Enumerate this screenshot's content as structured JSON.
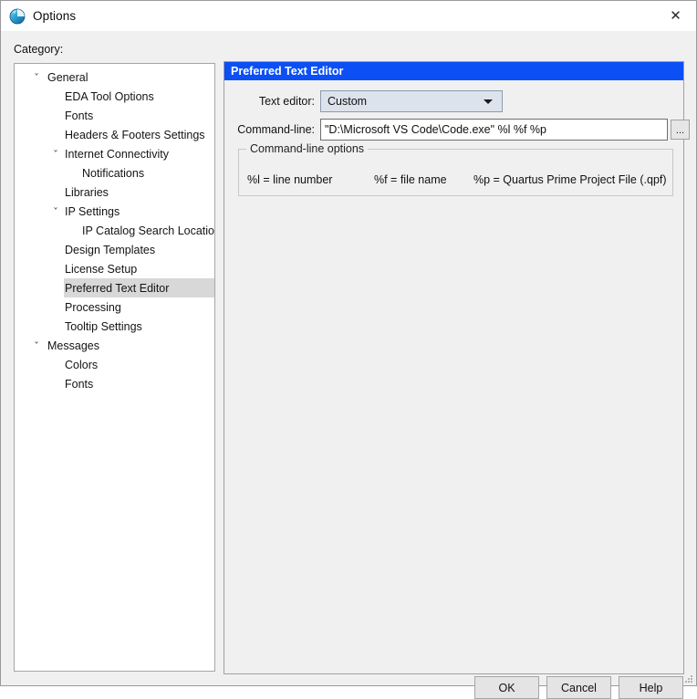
{
  "window": {
    "title": "Options",
    "icon": "quartus-sphere-icon",
    "close_label": "✕"
  },
  "category": {
    "label": "Category:",
    "tree": [
      {
        "label": "General",
        "level": 0,
        "expander": "˅",
        "selected": false
      },
      {
        "label": "EDA Tool Options",
        "level": 1,
        "expander": "",
        "selected": false
      },
      {
        "label": "Fonts",
        "level": 1,
        "expander": "",
        "selected": false
      },
      {
        "label": "Headers & Footers Settings",
        "level": 1,
        "expander": "",
        "selected": false
      },
      {
        "label": "Internet Connectivity",
        "level": 1,
        "expander": "˅",
        "selected": false
      },
      {
        "label": "Notifications",
        "level": 2,
        "expander": "",
        "selected": false
      },
      {
        "label": "Libraries",
        "level": 1,
        "expander": "",
        "selected": false
      },
      {
        "label": "IP Settings",
        "level": 1,
        "expander": "˅",
        "selected": false
      },
      {
        "label": "IP Catalog Search Locations",
        "level": 2,
        "expander": "",
        "selected": false
      },
      {
        "label": "Design Templates",
        "level": 1,
        "expander": "",
        "selected": false
      },
      {
        "label": "License Setup",
        "level": 1,
        "expander": "",
        "selected": false
      },
      {
        "label": "Preferred Text Editor",
        "level": 1,
        "expander": "",
        "selected": true
      },
      {
        "label": "Processing",
        "level": 1,
        "expander": "",
        "selected": false
      },
      {
        "label": "Tooltip Settings",
        "level": 1,
        "expander": "",
        "selected": false
      },
      {
        "label": "Messages",
        "level": 0,
        "expander": "˅",
        "selected": false
      },
      {
        "label": "Colors",
        "level": 1,
        "expander": "",
        "selected": false
      },
      {
        "label": "Fonts",
        "level": 1,
        "expander": "",
        "selected": false
      }
    ]
  },
  "panel": {
    "header": "Preferred Text Editor",
    "header_color": "#0b4ff5",
    "text_editor": {
      "label": "Text editor:",
      "value": "Custom",
      "arrow_icon": "chevron-down-icon"
    },
    "command_line": {
      "label": "Command-line:",
      "value": "\"D:\\Microsoft VS Code\\Code.exe\" %l %f %p",
      "browse_label": "..."
    },
    "options_group": {
      "title": "Command-line options",
      "items": [
        "%l = line number",
        "%f = file name",
        "%p = Quartus Prime Project File (.qpf)"
      ]
    }
  },
  "footer": {
    "ok": "OK",
    "cancel": "Cancel",
    "help": "Help"
  }
}
